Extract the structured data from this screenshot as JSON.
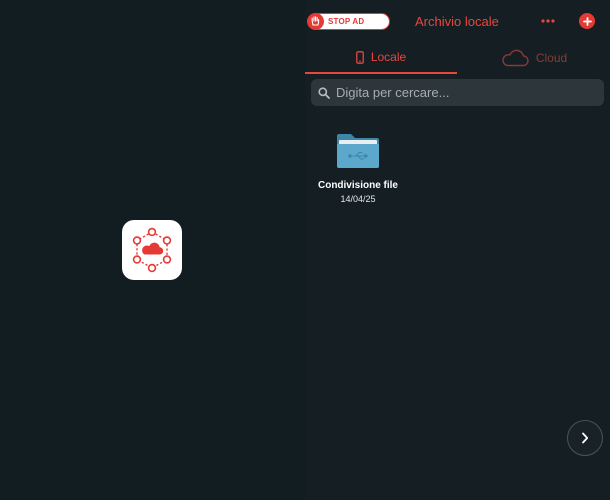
{
  "header": {
    "stop_ad_label": "STOP AD",
    "title": "Archivio locale"
  },
  "tabs": [
    {
      "label": "Locale",
      "icon": "phone-icon",
      "active": true
    },
    {
      "label": "Cloud",
      "icon": "cloud-icon",
      "active": false
    }
  ],
  "search": {
    "placeholder": "Digita per cercare..."
  },
  "files": [
    {
      "name": "Condivisione file",
      "date": "14/04/25",
      "icon": "usb-folder-icon"
    }
  ],
  "colors": {
    "accent": "#e8473d",
    "background": "#121d22",
    "search_bg": "#2d363b"
  },
  "icons": {
    "logo": "cloud-network-logo",
    "more": "more-horizontal-icon",
    "add": "plus-icon",
    "search": "search-icon",
    "next": "chevron-right-icon"
  }
}
